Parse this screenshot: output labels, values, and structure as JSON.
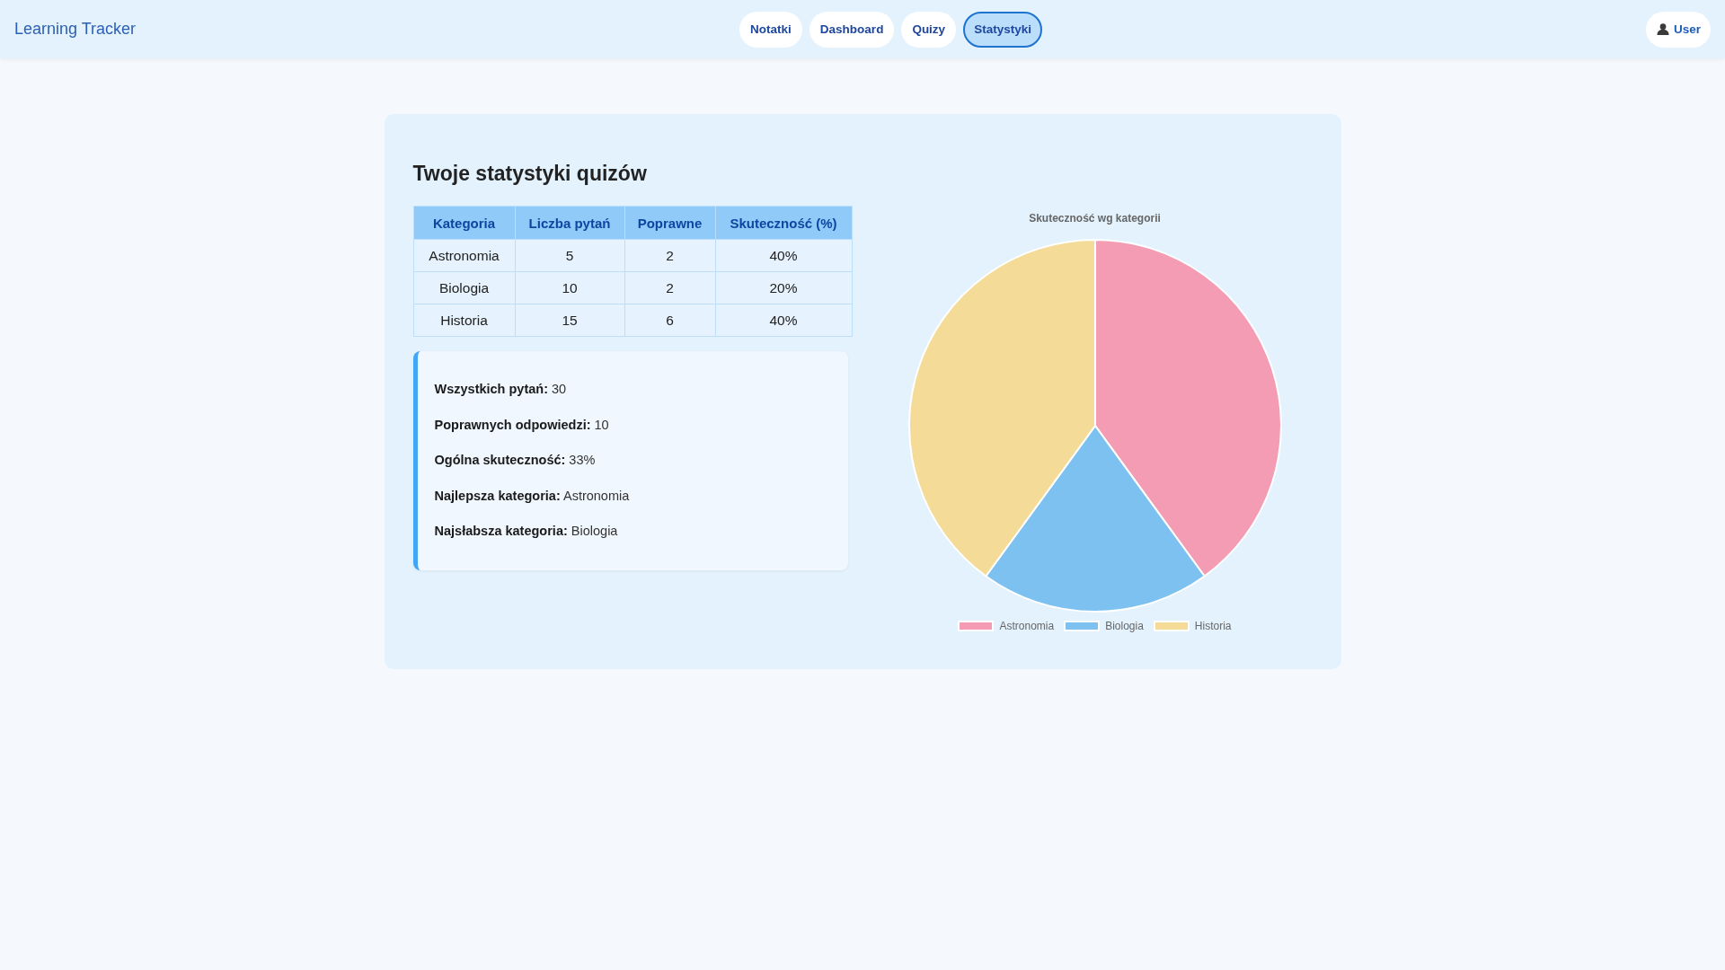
{
  "header": {
    "brand": "Learning Tracker",
    "tabs": [
      {
        "label": "Notatki",
        "selected": false
      },
      {
        "label": "Dashboard",
        "selected": false
      },
      {
        "label": "Quizy",
        "selected": false
      },
      {
        "label": "Statystyki",
        "selected": true
      }
    ],
    "user_button": {
      "label": "User"
    }
  },
  "stats_card": {
    "title": "Twoje statystyki quizów",
    "table": {
      "columns": [
        "Kategoria",
        "Liczba pytań",
        "Poprawne",
        "Skuteczność (%)"
      ],
      "rows": [
        [
          "Astronomia",
          "5",
          "2",
          "40%"
        ],
        [
          "Biologia",
          "10",
          "2",
          "20%"
        ],
        [
          "Historia",
          "15",
          "6",
          "40%"
        ]
      ]
    },
    "summary": [
      {
        "label": "Wszystkich pytań:",
        "value": "30"
      },
      {
        "label": "Poprawnych odpowiedzi:",
        "value": "10"
      },
      {
        "label": "Ogólna skuteczność:",
        "value": "33%"
      },
      {
        "label": "Najlepsza kategoria:",
        "value": "Astronomia"
      },
      {
        "label": "Najsłabsza kategoria:",
        "value": "Biologia"
      }
    ],
    "chart_data": {
      "type": "pie",
      "title": "Skuteczność wg kategorii",
      "categories": [
        "Astronomia",
        "Biologia",
        "Historia"
      ],
      "values": [
        40,
        20,
        40
      ],
      "colors": [
        "#f49cb4",
        "#7dc1f1",
        "#f4dc98"
      ],
      "legend": "bottom"
    }
  }
}
